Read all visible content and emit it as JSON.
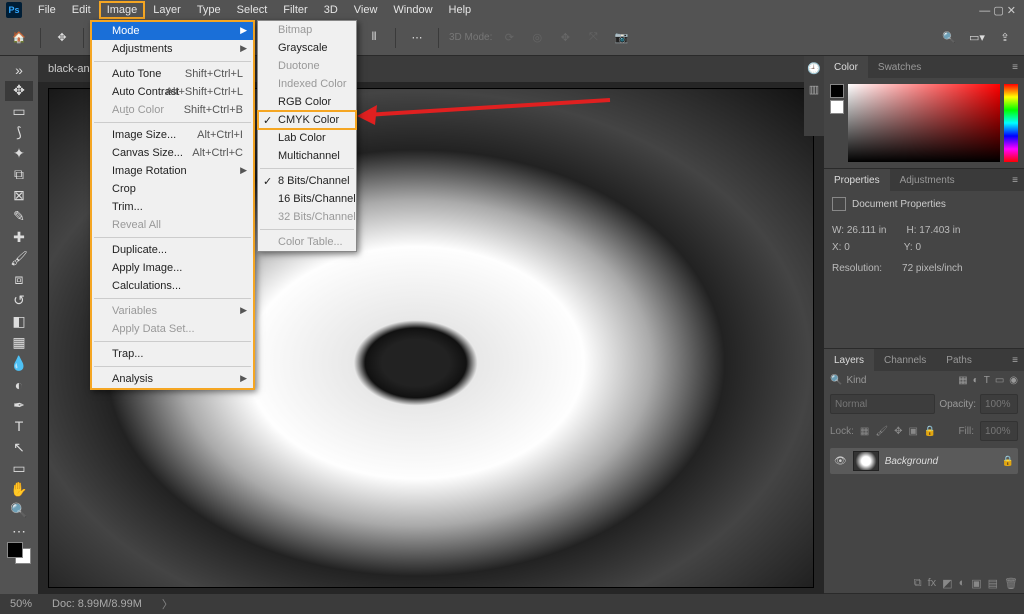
{
  "app": {
    "logo": "Ps"
  },
  "menubar": [
    "File",
    "Edit",
    "Image",
    "Layer",
    "Type",
    "Select",
    "Filter",
    "3D",
    "View",
    "Window",
    "Help"
  ],
  "menubar_highlight_index": 2,
  "tab": {
    "label": "black-and-..."
  },
  "image_menu": {
    "items": [
      {
        "label": "Mode",
        "arrow": true,
        "highlighted": true
      },
      {
        "label": "Adjustments",
        "arrow": true
      },
      {
        "sep": true
      },
      {
        "label": "Auto Tone",
        "shortcut": "Shift+Ctrl+L"
      },
      {
        "label": "Auto Contrast",
        "shortcut": "Alt+Shift+Ctrl+L"
      },
      {
        "label": "Auto Color",
        "shortcut": "Shift+Ctrl+B",
        "disabled": true,
        "underline": 2
      },
      {
        "sep": true
      },
      {
        "label": "Image Size...",
        "shortcut": "Alt+Ctrl+I"
      },
      {
        "label": "Canvas Size...",
        "shortcut": "Alt+Ctrl+C"
      },
      {
        "label": "Image Rotation",
        "arrow": true
      },
      {
        "label": "Crop"
      },
      {
        "label": "Trim..."
      },
      {
        "label": "Reveal All",
        "disabled": true
      },
      {
        "sep": true
      },
      {
        "label": "Duplicate..."
      },
      {
        "label": "Apply Image..."
      },
      {
        "label": "Calculations..."
      },
      {
        "sep": true
      },
      {
        "label": "Variables",
        "arrow": true,
        "disabled": true
      },
      {
        "label": "Apply Data Set...",
        "disabled": true
      },
      {
        "sep": true
      },
      {
        "label": "Trap..."
      },
      {
        "sep": true
      },
      {
        "label": "Analysis",
        "arrow": true
      }
    ]
  },
  "mode_menu": {
    "items": [
      {
        "label": "Bitmap",
        "disabled": true
      },
      {
        "label": "Grayscale"
      },
      {
        "label": "Duotone",
        "disabled": true
      },
      {
        "label": "Indexed Color",
        "disabled": true
      },
      {
        "label": "RGB Color"
      },
      {
        "label": "CMYK Color",
        "checked": true,
        "boxed": true
      },
      {
        "label": "Lab Color"
      },
      {
        "label": "Multichannel"
      },
      {
        "sep": true
      },
      {
        "label": "8 Bits/Channel",
        "checked": true
      },
      {
        "label": "16 Bits/Channel"
      },
      {
        "label": "32 Bits/Channel",
        "disabled": true
      },
      {
        "sep": true
      },
      {
        "label": "Color Table...",
        "disabled": true
      }
    ]
  },
  "options": {
    "model_label": "3D Mode:"
  },
  "panels": {
    "color": {
      "tabs": [
        "Color",
        "Swatches"
      ],
      "active": 0
    },
    "properties": {
      "tabs": [
        "Properties",
        "Adjustments"
      ],
      "active": 0,
      "header": "Document Properties",
      "w_label": "W:",
      "w_val": "26.111 in",
      "h_label": "H:",
      "h_val": "17.403 in",
      "x_label": "X:",
      "x_val": "0",
      "y_label": "Y:",
      "y_val": "0",
      "res_label": "Resolution:",
      "res_val": "72 pixels/inch"
    },
    "layers": {
      "tabs": [
        "Layers",
        "Channels",
        "Paths"
      ],
      "active": 0,
      "search_icon": "🔍",
      "kind": "Kind",
      "blend": "Normal",
      "opacity_label": "Opacity:",
      "opacity_val": "100%",
      "lock_label": "Lock:",
      "fill_label": "Fill:",
      "fill_val": "100%",
      "layer_name": "Background"
    }
  },
  "status": {
    "zoom": "50%",
    "doc": "Doc: 8.99M/8.99M"
  }
}
